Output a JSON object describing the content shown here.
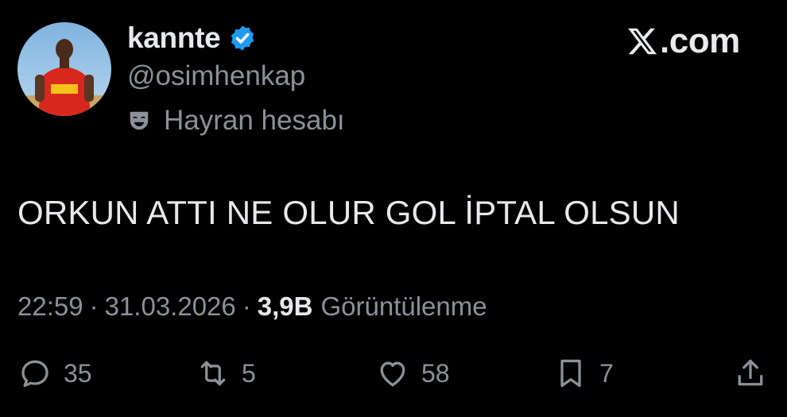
{
  "post": {
    "display_name": "kannte",
    "handle": "@osimhenkap",
    "account_label": "Hayran hesabı",
    "brand": "X",
    "brand_domain": ".com",
    "text": "ORKUN ATTI NE OLUR GOL İPTAL OLSUN",
    "time": "22:59",
    "separator": "·",
    "date": "31.03.2026",
    "views_count": "3,9B",
    "views_label": "Görüntülenme"
  },
  "actions": {
    "replies": "35",
    "reposts": "5",
    "likes": "58",
    "bookmarks": "7"
  },
  "icons": {
    "verified": "verified-badge-icon",
    "label": "theater-mask-icon",
    "reply": "reply-icon",
    "repost": "repost-icon",
    "like": "heart-icon",
    "bookmark": "bookmark-icon",
    "share": "share-icon"
  },
  "colors": {
    "background": "#000000",
    "primary_text": "#e7e9ea",
    "secondary_text": "#8b9198",
    "verified_blue": "#1d9bf0"
  }
}
